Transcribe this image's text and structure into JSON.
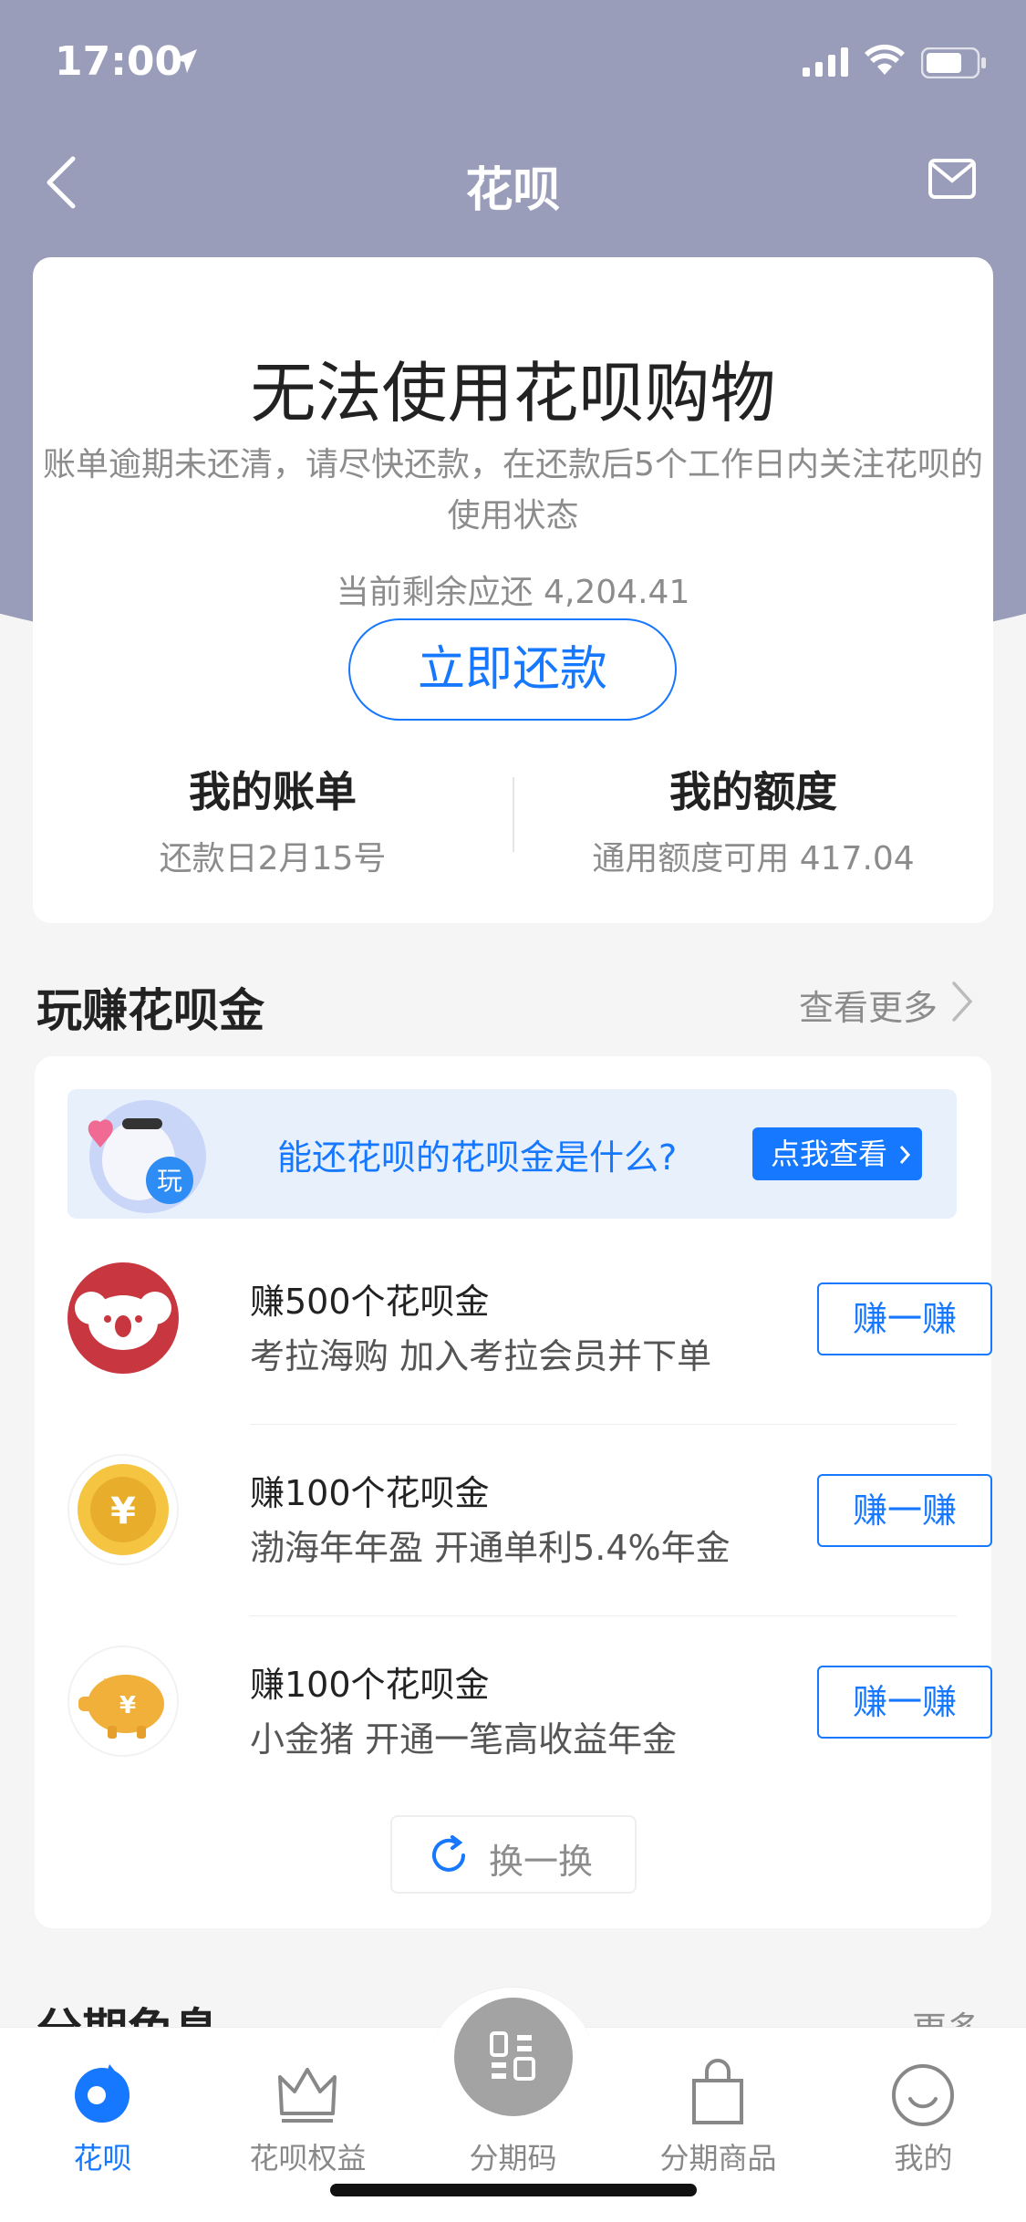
{
  "status": {
    "time": "17:00"
  },
  "nav": {
    "title": "花呗"
  },
  "main": {
    "title": "无法使用花呗购物",
    "desc": "账单逾期未还清，请尽快还款，在还款后5个工作日内关注花呗的使用状态",
    "remaining": "当前剩余应还 4,204.41",
    "repay_label": "立即还款",
    "bill_title": "我的账单",
    "bill_sub": "还款日2月15号",
    "quota_title": "我的额度",
    "quota_sub": "通用额度可用 417.04"
  },
  "earn": {
    "title": "玩赚花呗金",
    "more": "查看更多",
    "banner_text": "能还花呗的花呗金是什么?",
    "banner_btn": "点我查看",
    "banner_badge": "玩",
    "tasks": [
      {
        "title": "赚500个花呗金",
        "sub": "考拉海购 加入考拉会员并下单",
        "btn": "赚一赚",
        "icon": "koala-icon"
      },
      {
        "title": "赚100个花呗金",
        "sub": "渤海年年盈 开通单利5.4%年金",
        "btn": "赚一赚",
        "icon": "coin-icon"
      },
      {
        "title": "赚100个花呗金",
        "sub": "小金猪 开通一笔高收益年金",
        "btn": "赚一赚",
        "icon": "piggy-bank-icon"
      }
    ],
    "refresh": "换一换",
    "coin_symbol": "¥"
  },
  "next": {
    "title": "分期免息",
    "more": "更多"
  },
  "tabs": [
    {
      "label": "花呗",
      "icon": "huabei-icon",
      "active": true
    },
    {
      "label": "花呗权益",
      "icon": "crown-icon",
      "active": false
    },
    {
      "label": "分期码",
      "icon": "qr-code-icon",
      "active": false
    },
    {
      "label": "分期商品",
      "icon": "shopping-bag-icon",
      "active": false
    },
    {
      "label": "我的",
      "icon": "smile-icon",
      "active": false
    }
  ],
  "colors": {
    "accent": "#1677ff",
    "header": "#9a9db9"
  }
}
